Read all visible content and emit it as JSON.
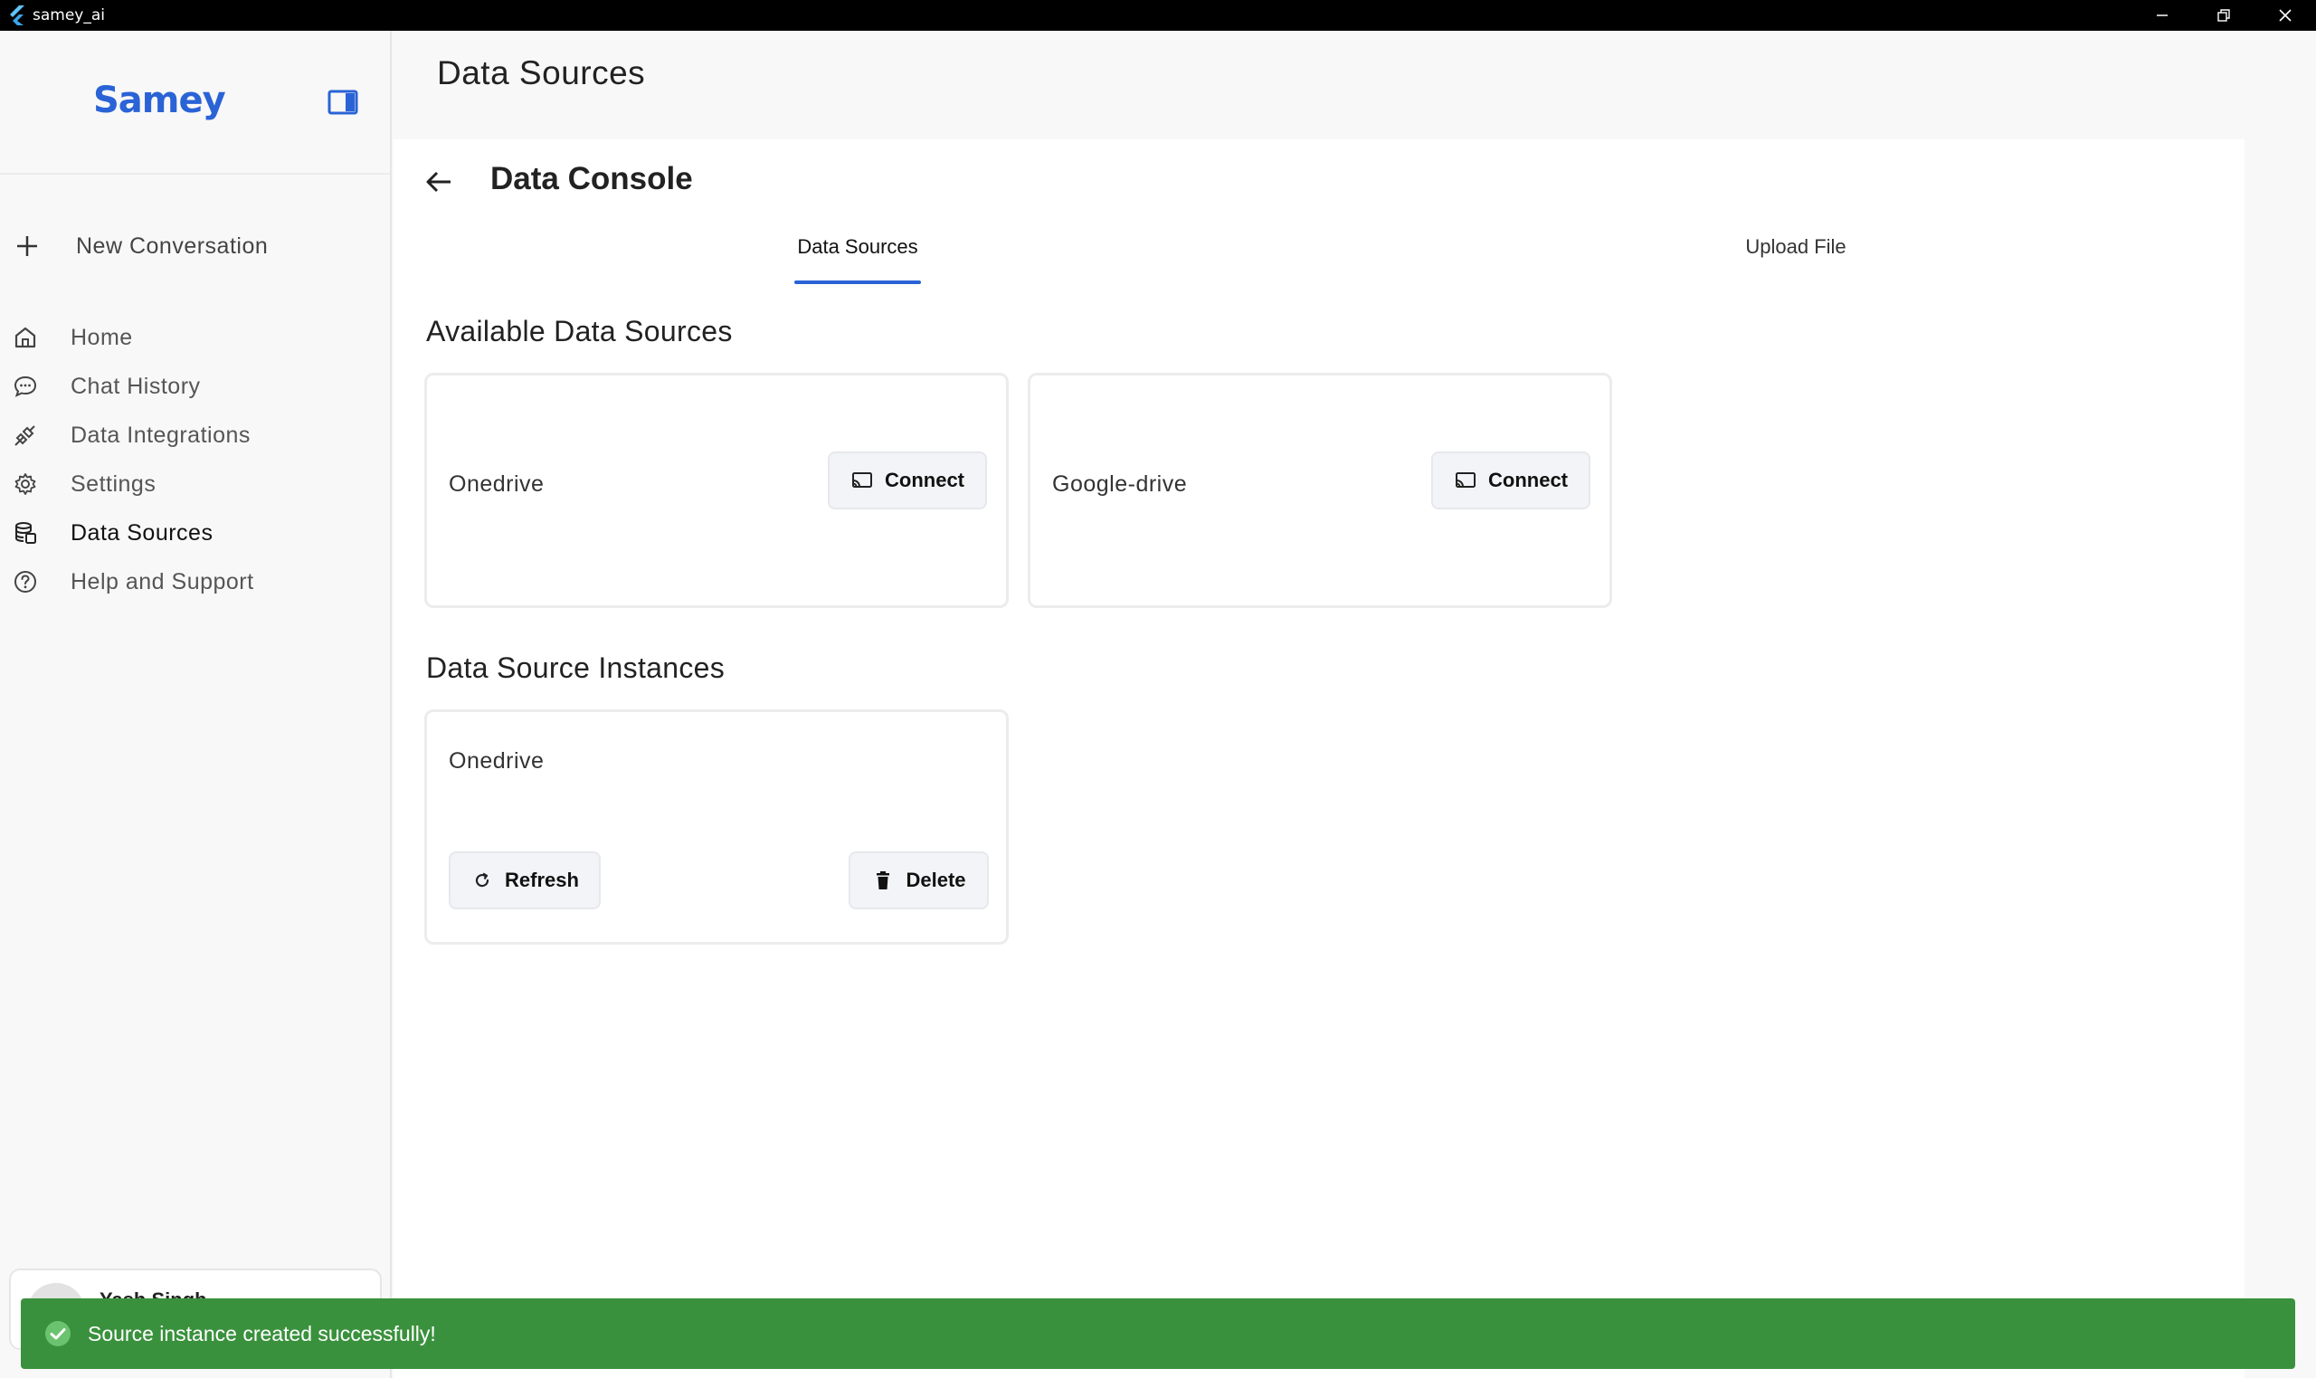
{
  "window": {
    "title": "samey_ai"
  },
  "sidebar": {
    "brand": "Samey",
    "new_conversation": "New Conversation",
    "items": [
      {
        "label": "Home",
        "icon": "home-icon"
      },
      {
        "label": "Chat History",
        "icon": "chat-bubble-icon"
      },
      {
        "label": "Data Integrations",
        "icon": "plug-icon"
      },
      {
        "label": "Settings",
        "icon": "gear-icon"
      },
      {
        "label": "Data Sources",
        "icon": "database-icon",
        "active": true
      },
      {
        "label": "Help and Support",
        "icon": "help-circle-icon"
      }
    ],
    "user": {
      "name": "Yash Singh"
    }
  },
  "main": {
    "page_title": "Data Sources",
    "console_title": "Data Console",
    "tabs": [
      {
        "label": "Data Sources",
        "active": true
      },
      {
        "label": "Upload File",
        "active": false
      }
    ],
    "available_title": "Available Data Sources",
    "available_sources": [
      {
        "name": "Onedrive",
        "action": "Connect"
      },
      {
        "name": "Google-drive",
        "action": "Connect"
      }
    ],
    "instances_title": "Data Source Instances",
    "instances": [
      {
        "name": "Onedrive",
        "refresh": "Refresh",
        "delete": "Delete"
      }
    ]
  },
  "toast": {
    "message": "Source instance created successfully!"
  },
  "colors": {
    "accent": "#2a63d6",
    "toast": "#3a913d",
    "titlebar": "#000000"
  }
}
